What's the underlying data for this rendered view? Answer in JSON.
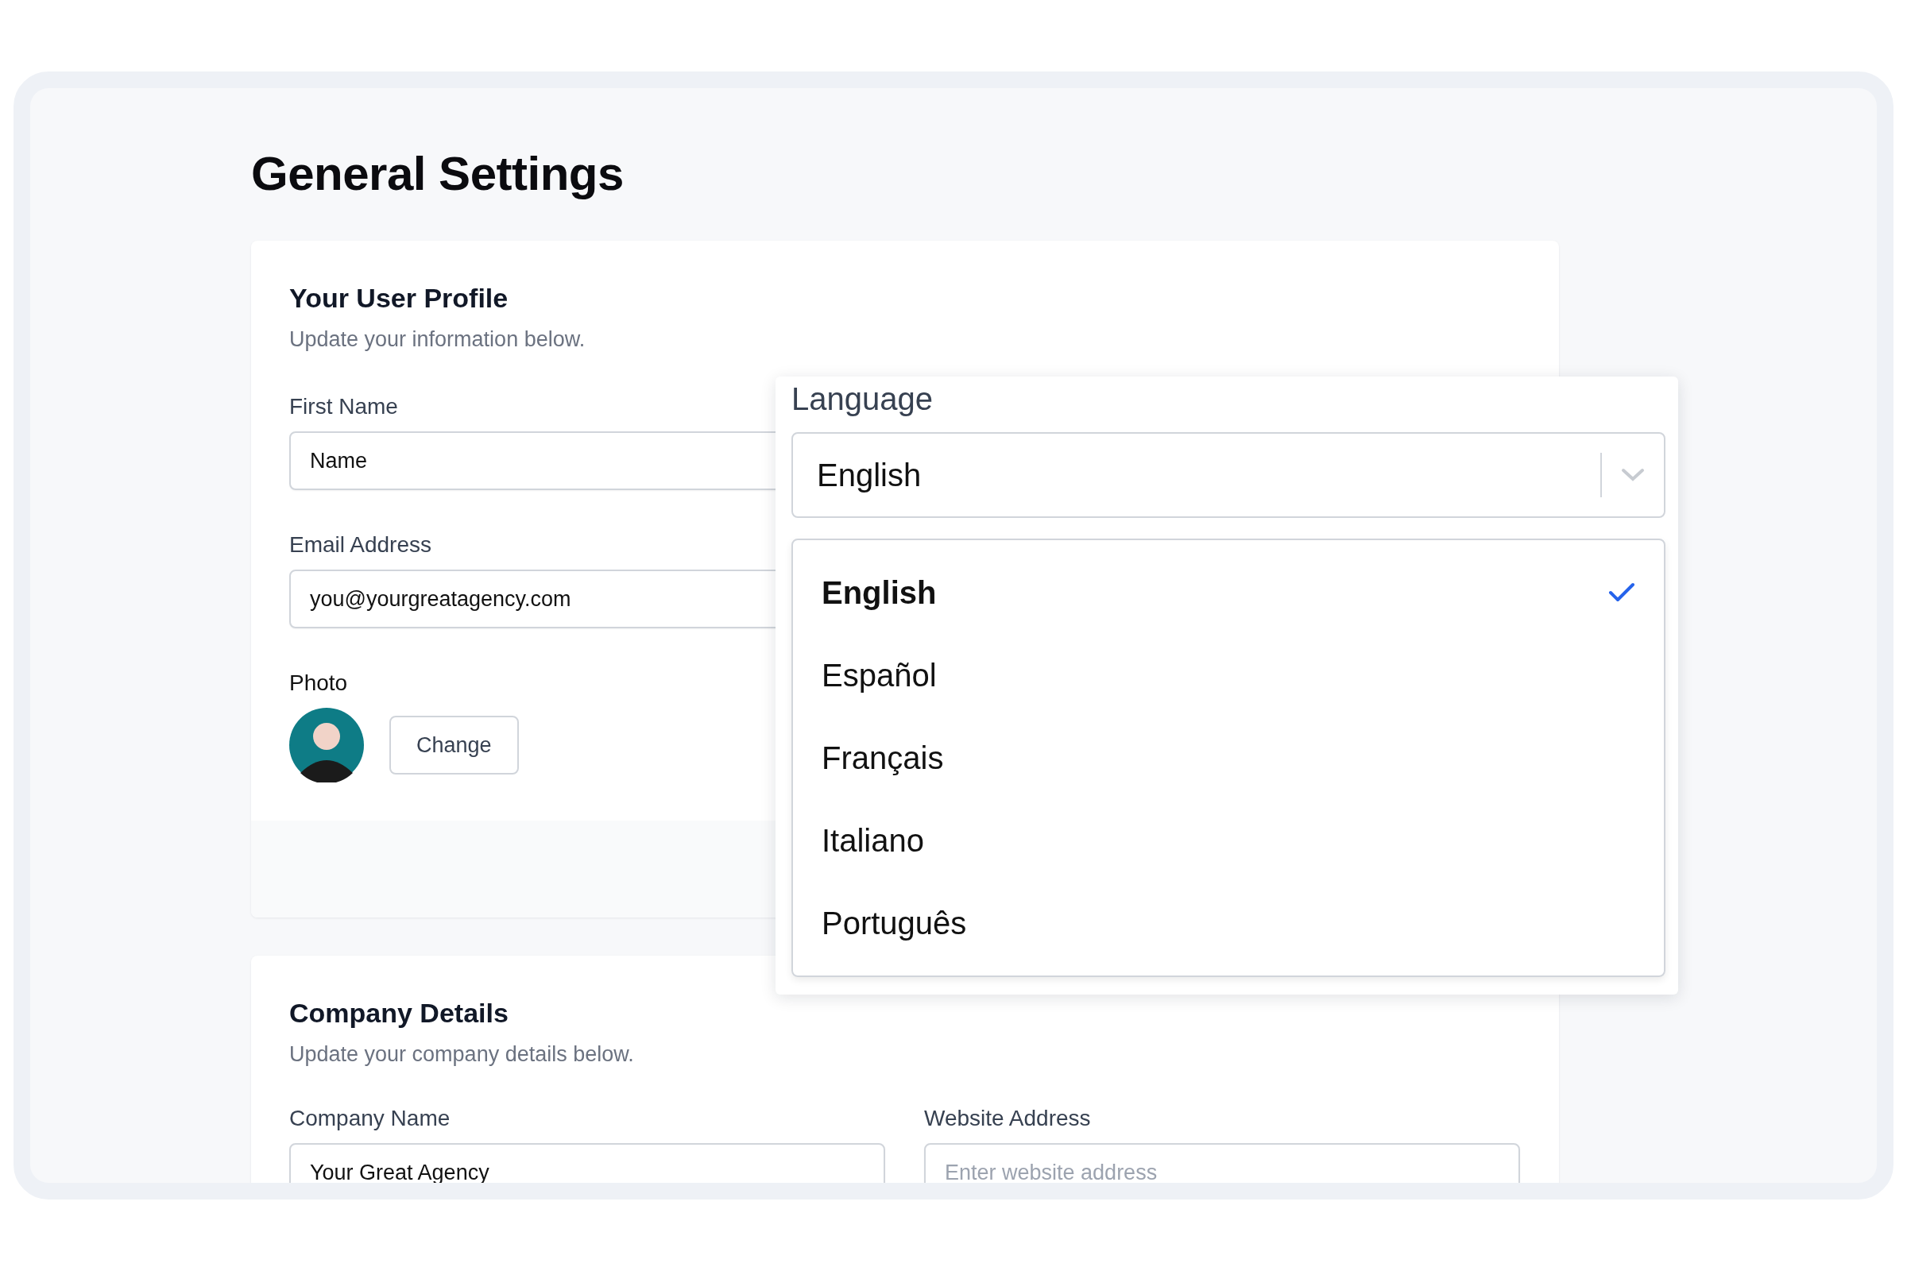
{
  "page": {
    "title": "General Settings"
  },
  "profile": {
    "title": "Your User Profile",
    "subtitle": "Update your information below.",
    "fields": [
      {
        "label": "First Name",
        "value": "Name"
      },
      {
        "label": "Email Address",
        "value": "you@yourgreatagency.com"
      }
    ],
    "photo": {
      "label": "Photo",
      "button": "Change"
    }
  },
  "language": {
    "label": "Language",
    "value": "English",
    "options": [
      {
        "label": "English",
        "selected": true
      },
      {
        "label": "Español",
        "selected": false
      },
      {
        "label": "Français",
        "selected": false
      },
      {
        "label": "Italiano",
        "selected": false
      },
      {
        "label": "Português",
        "selected": false
      }
    ]
  },
  "company": {
    "title": "Company Details",
    "subtitle": "Update your company details below.",
    "fields": [
      {
        "label": "Company Name",
        "value": "Your Great Agency"
      },
      {
        "label": "Website Address",
        "placeholder": "Enter website address"
      }
    ]
  }
}
